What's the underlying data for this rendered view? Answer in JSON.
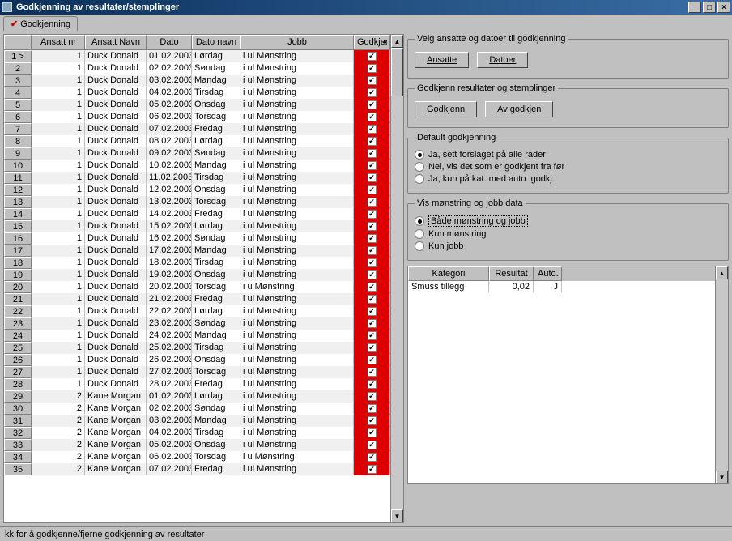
{
  "title": "Godkjenning av resultater/stemplinger",
  "tab_label": "Godkjenning",
  "columns": {
    "rowhdr": "",
    "ansnr": "Ansatt nr",
    "navn": "Ansatt Navn",
    "dato": "Dato",
    "dnavn": "Dato navn",
    "jobb": "Jobb",
    "god": "Godkjent"
  },
  "rows": [
    {
      "n": "1 >",
      "nr": "1",
      "navn": "Duck Donald",
      "dato": "01.02.2003",
      "dnavn": "Lørdag",
      "jobb": "i ul Mønstring",
      "g": true
    },
    {
      "n": "2",
      "nr": "1",
      "navn": "Duck Donald",
      "dato": "02.02.2003",
      "dnavn": "Søndag",
      "jobb": "i ul Mønstring",
      "g": true
    },
    {
      "n": "3",
      "nr": "1",
      "navn": "Duck Donald",
      "dato": "03.02.2003",
      "dnavn": "Mandag",
      "jobb": "i ul Mønstring",
      "g": true
    },
    {
      "n": "4",
      "nr": "1",
      "navn": "Duck Donald",
      "dato": "04.02.2003",
      "dnavn": "Tirsdag",
      "jobb": "i ul Mønstring",
      "g": true
    },
    {
      "n": "5",
      "nr": "1",
      "navn": "Duck Donald",
      "dato": "05.02.2003",
      "dnavn": "Onsdag",
      "jobb": "i ul Mønstring",
      "g": true
    },
    {
      "n": "6",
      "nr": "1",
      "navn": "Duck Donald",
      "dato": "06.02.2003",
      "dnavn": "Torsdag",
      "jobb": "i ul Mønstring",
      "g": true
    },
    {
      "n": "7",
      "nr": "1",
      "navn": "Duck Donald",
      "dato": "07.02.2003",
      "dnavn": "Fredag",
      "jobb": "i ul Mønstring",
      "g": true
    },
    {
      "n": "8",
      "nr": "1",
      "navn": "Duck Donald",
      "dato": "08.02.2003",
      "dnavn": "Lørdag",
      "jobb": "i ul Mønstring",
      "g": true
    },
    {
      "n": "9",
      "nr": "1",
      "navn": "Duck Donald",
      "dato": "09.02.2003",
      "dnavn": "Søndag",
      "jobb": "i ul Mønstring",
      "g": true
    },
    {
      "n": "10",
      "nr": "1",
      "navn": "Duck Donald",
      "dato": "10.02.2003",
      "dnavn": "Mandag",
      "jobb": "i ul Mønstring",
      "g": true
    },
    {
      "n": "11",
      "nr": "1",
      "navn": "Duck Donald",
      "dato": "11.02.2003",
      "dnavn": "Tirsdag",
      "jobb": "i ul Mønstring",
      "g": true
    },
    {
      "n": "12",
      "nr": "1",
      "navn": "Duck Donald",
      "dato": "12.02.2003",
      "dnavn": "Onsdag",
      "jobb": "i ul Mønstring",
      "g": true
    },
    {
      "n": "13",
      "nr": "1",
      "navn": "Duck Donald",
      "dato": "13.02.2003",
      "dnavn": "Torsdag",
      "jobb": "i ul Mønstring",
      "g": true
    },
    {
      "n": "14",
      "nr": "1",
      "navn": "Duck Donald",
      "dato": "14.02.2003",
      "dnavn": "Fredag",
      "jobb": "i ul Mønstring",
      "g": true
    },
    {
      "n": "15",
      "nr": "1",
      "navn": "Duck Donald",
      "dato": "15.02.2003",
      "dnavn": "Lørdag",
      "jobb": "i ul Mønstring",
      "g": true
    },
    {
      "n": "16",
      "nr": "1",
      "navn": "Duck Donald",
      "dato": "16.02.2003",
      "dnavn": "Søndag",
      "jobb": "i ul Mønstring",
      "g": true
    },
    {
      "n": "17",
      "nr": "1",
      "navn": "Duck Donald",
      "dato": "17.02.2003",
      "dnavn": "Mandag",
      "jobb": "i ul Mønstring",
      "g": true
    },
    {
      "n": "18",
      "nr": "1",
      "navn": "Duck Donald",
      "dato": "18.02.2003",
      "dnavn": "Tirsdag",
      "jobb": "i ul Mønstring",
      "g": true
    },
    {
      "n": "19",
      "nr": "1",
      "navn": "Duck Donald",
      "dato": "19.02.2003",
      "dnavn": "Onsdag",
      "jobb": "i ul Mønstring",
      "g": true
    },
    {
      "n": "20",
      "nr": "1",
      "navn": "Duck Donald",
      "dato": "20.02.2003",
      "dnavn": "Torsdag",
      "jobb": "i u Mønstring",
      "g": true
    },
    {
      "n": "21",
      "nr": "1",
      "navn": "Duck Donald",
      "dato": "21.02.2003",
      "dnavn": "Fredag",
      "jobb": "i ul Mønstring",
      "g": true
    },
    {
      "n": "22",
      "nr": "1",
      "navn": "Duck Donald",
      "dato": "22.02.2003",
      "dnavn": "Lørdag",
      "jobb": "i ul Mønstring",
      "g": true
    },
    {
      "n": "23",
      "nr": "1",
      "navn": "Duck Donald",
      "dato": "23.02.2003",
      "dnavn": "Søndag",
      "jobb": "i ul Mønstring",
      "g": true
    },
    {
      "n": "24",
      "nr": "1",
      "navn": "Duck Donald",
      "dato": "24.02.2003",
      "dnavn": "Mandag",
      "jobb": "i ul Mønstring",
      "g": true
    },
    {
      "n": "25",
      "nr": "1",
      "navn": "Duck Donald",
      "dato": "25.02.2003",
      "dnavn": "Tirsdag",
      "jobb": "i ul Mønstring",
      "g": true
    },
    {
      "n": "26",
      "nr": "1",
      "navn": "Duck Donald",
      "dato": "26.02.2003",
      "dnavn": "Onsdag",
      "jobb": "i ul Mønstring",
      "g": true
    },
    {
      "n": "27",
      "nr": "1",
      "navn": "Duck Donald",
      "dato": "27.02.2003",
      "dnavn": "Torsdag",
      "jobb": "i ul Mønstring",
      "g": true
    },
    {
      "n": "28",
      "nr": "1",
      "navn": "Duck Donald",
      "dato": "28.02.2003",
      "dnavn": "Fredag",
      "jobb": "i ul Mønstring",
      "g": true
    },
    {
      "n": "29",
      "nr": "2",
      "navn": "Kane Morgan",
      "dato": "01.02.2003",
      "dnavn": "Lørdag",
      "jobb": "i ul Mønstring",
      "g": true
    },
    {
      "n": "30",
      "nr": "2",
      "navn": "Kane Morgan",
      "dato": "02.02.2003",
      "dnavn": "Søndag",
      "jobb": "i ul Mønstring",
      "g": true
    },
    {
      "n": "31",
      "nr": "2",
      "navn": "Kane Morgan",
      "dato": "03.02.2003",
      "dnavn": "Mandag",
      "jobb": "i ul Mønstring",
      "g": true
    },
    {
      "n": "32",
      "nr": "2",
      "navn": "Kane Morgan",
      "dato": "04.02.2003",
      "dnavn": "Tirsdag",
      "jobb": "i ul Mønstring",
      "g": true
    },
    {
      "n": "33",
      "nr": "2",
      "navn": "Kane Morgan",
      "dato": "05.02.2003",
      "dnavn": "Onsdag",
      "jobb": "i ul Mønstring",
      "g": true
    },
    {
      "n": "34",
      "nr": "2",
      "navn": "Kane Morgan",
      "dato": "06.02.2003",
      "dnavn": "Torsdag",
      "jobb": "i u Mønstring",
      "g": true
    },
    {
      "n": "35",
      "nr": "2",
      "navn": "Kane Morgan",
      "dato": "07.02.2003",
      "dnavn": "Fredag",
      "jobb": "i ul Mønstring",
      "g": true
    }
  ],
  "panel1": {
    "legend": "Velg ansatte og datoer til godkjenning",
    "btn_ansatte": "Ansatte",
    "btn_datoer": "Datoer"
  },
  "panel2": {
    "legend": "Godkjenn resultater og stemplinger",
    "btn_godkjenn": "Godkjenn",
    "btn_avgodkjen": "Av godkjen"
  },
  "panel3": {
    "legend": "Default godkjenning",
    "opt1": "Ja, sett forslaget på alle rader",
    "opt2": "Nei, vis det som er godkjent fra før",
    "opt3": "Ja, kun på kat. med auto. godkj."
  },
  "panel4": {
    "legend": "Vis mønstring og jobb data",
    "opt1": "Både mønstring og jobb",
    "opt2": "Kun mønstring",
    "opt3": "Kun jobb"
  },
  "smalltable": {
    "h_kat": "Kategori",
    "h_res": "Resultat",
    "h_auto": "Auto.",
    "rows": [
      {
        "kat": "Smuss tillegg",
        "res": "0,02",
        "auto": "J"
      }
    ]
  },
  "status": "kk for å godkjenne/fjerne godkjenning av resultater"
}
